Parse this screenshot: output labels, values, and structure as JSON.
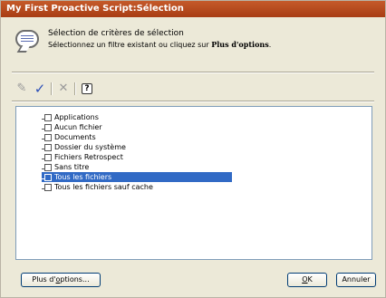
{
  "window": {
    "title": "My First Proactive Script:Sélection"
  },
  "header": {
    "icon": "filter-speech-bubble-icon",
    "title": "Sélection de critères de sélection",
    "subtitle_prefix": "Sélectionnez un filtre existant ou cliquez sur ",
    "subtitle_bold": "Plus d'options",
    "subtitle_suffix": "."
  },
  "toolbar": {
    "icons": [
      "pencil-icon",
      "check-icon",
      "delete-icon",
      "help-icon"
    ],
    "check_glyph": "✓",
    "delete_glyph": "✕",
    "edit_glyph": "✎",
    "help_glyph": "?"
  },
  "list": {
    "items": [
      {
        "label": "Applications",
        "selected": false
      },
      {
        "label": "Aucun fichier",
        "selected": false
      },
      {
        "label": "Documents",
        "selected": false
      },
      {
        "label": "Dossier du système",
        "selected": false
      },
      {
        "label": "Fichiers Retrospect",
        "selected": false
      },
      {
        "label": "Sans titre",
        "selected": false
      },
      {
        "label": "Tous les fichiers",
        "selected": true
      },
      {
        "label": "Tous les fichiers sauf cache",
        "selected": false
      }
    ]
  },
  "buttons": {
    "more_prefix": "Plus d'",
    "more_underlined": "o",
    "more_suffix": "ptions...",
    "ok_underlined": "O",
    "ok_suffix": "K",
    "cancel": "Annuler"
  },
  "colors": {
    "title_bar": "#b84a1e",
    "selection": "#316ac5",
    "check": "#2b4fb8"
  }
}
